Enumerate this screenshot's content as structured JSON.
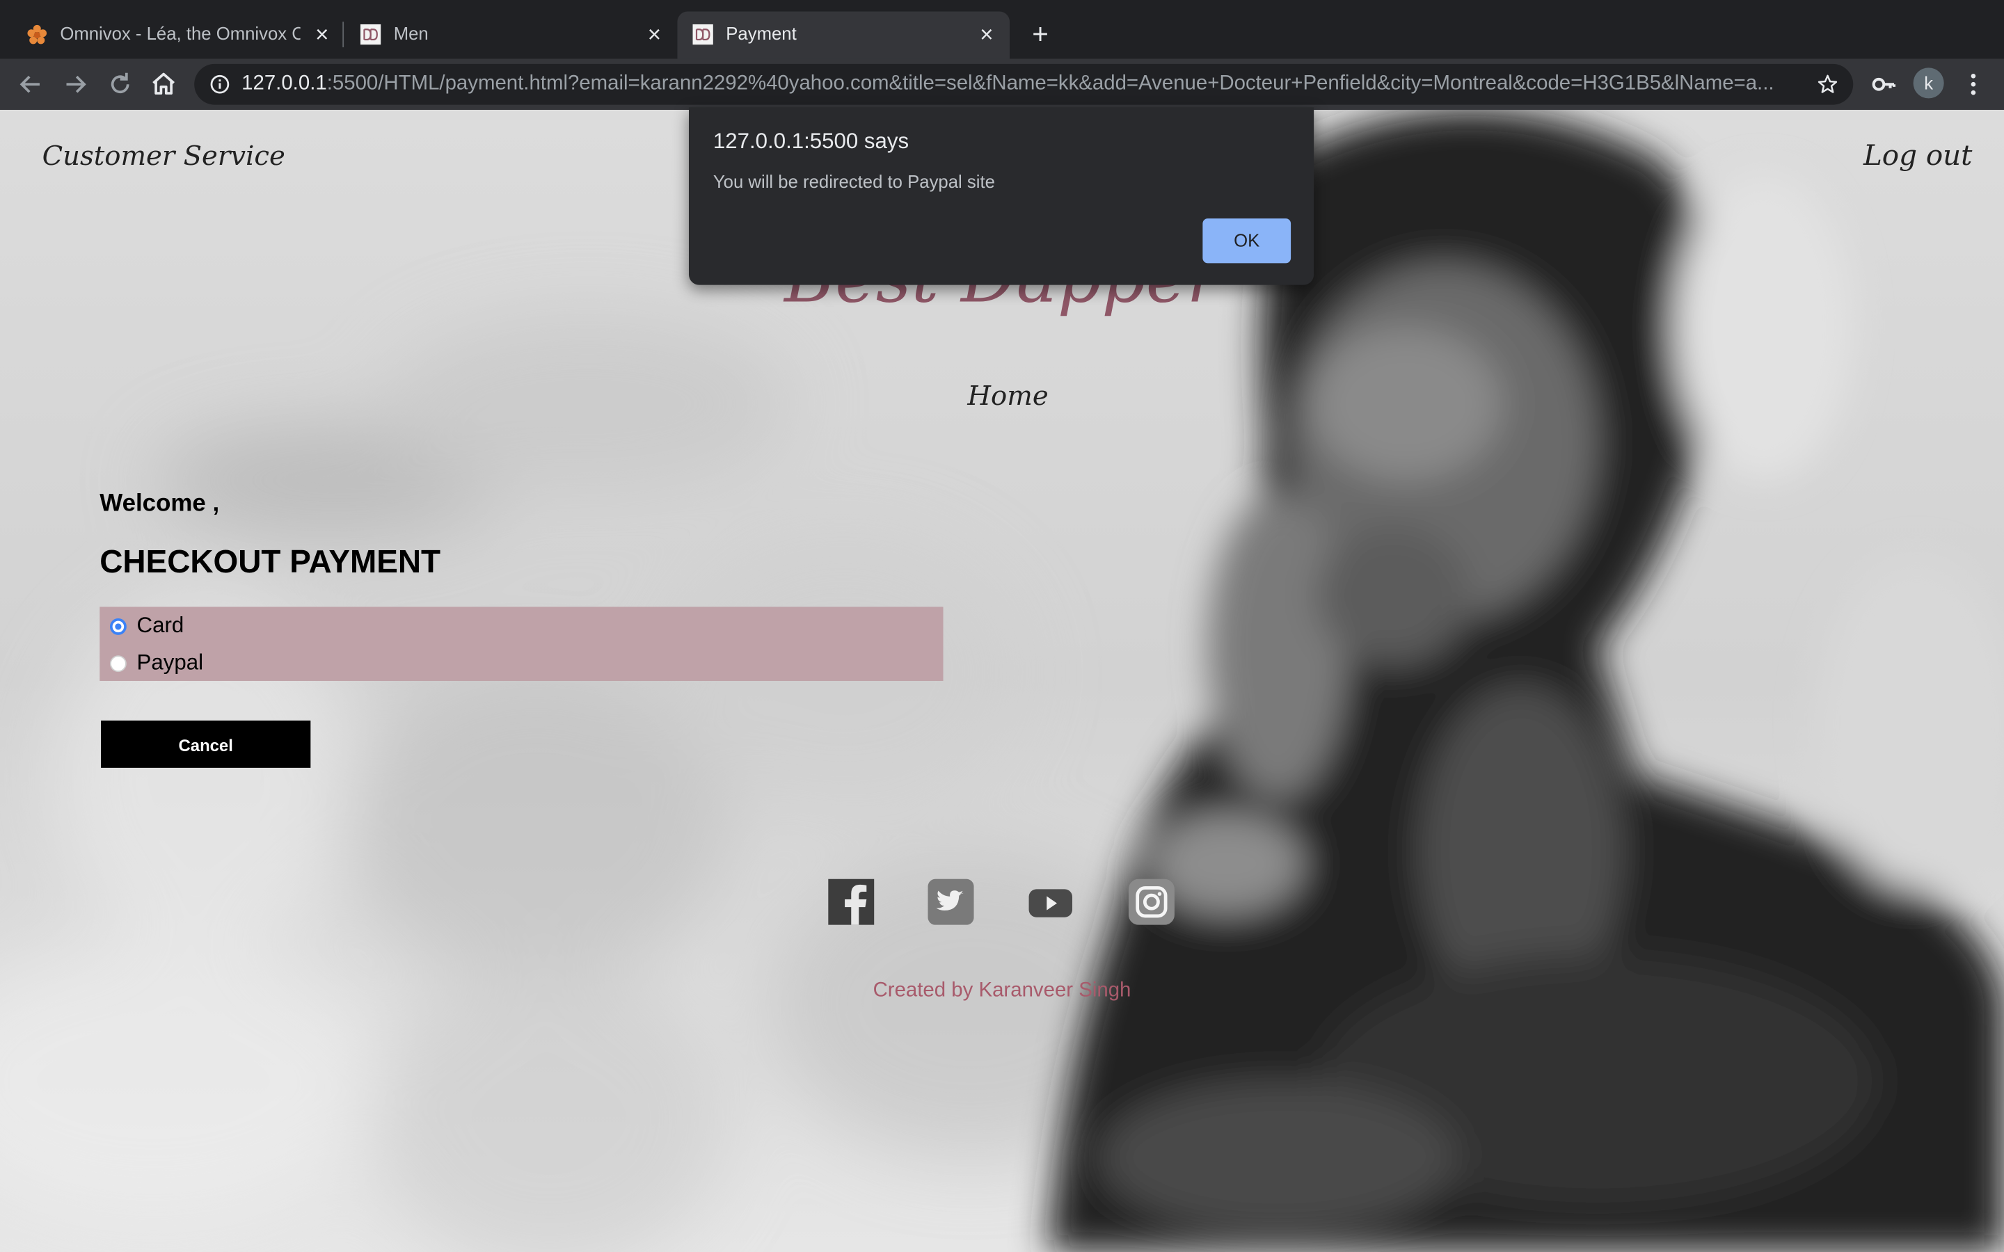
{
  "browser": {
    "tabs": [
      {
        "title": "Omnivox - Léa, the Omnivox Cl",
        "active": false,
        "favicon": "flower-icon"
      },
      {
        "title": "Men",
        "active": false,
        "favicon": "dd-logo-icon"
      },
      {
        "title": "Payment",
        "active": true,
        "favicon": "dd-logo-icon"
      }
    ],
    "new_tab_symbol": "+",
    "close_symbol": "×",
    "url_host": "127.0.0.1",
    "url_rest": ":5500/HTML/payment.html?email=karann2292%40yahoo.com&title=sel&fName=kk&add=Avenue+Docteur+Penfield&city=Montreal&code=H3G1B5&lName=a...",
    "profile_initial": "k"
  },
  "site": {
    "customer_service": "Customer Service",
    "logout": "Log out",
    "brand": "Best Dapper",
    "home": "Home",
    "welcome": "Welcome ,",
    "checkout_title": "CHECKOUT PAYMENT",
    "payment_options": [
      {
        "label": "Card",
        "checked": true
      },
      {
        "label": "Paypal",
        "checked": false
      }
    ],
    "cancel": "Cancel",
    "social": [
      "facebook-icon",
      "twitter-icon",
      "youtube-icon",
      "instagram-icon"
    ],
    "credit": "Created by Karanveer Singh"
  },
  "dialog": {
    "title": "127.0.0.1:5500 says",
    "message": "You will be redirected to Paypal site",
    "ok": "OK"
  },
  "colors": {
    "brand": "#8f5767",
    "payment_box": "#bfa2a8",
    "dialog_button": "#8ab4f8",
    "credit": "#a85a6b"
  }
}
